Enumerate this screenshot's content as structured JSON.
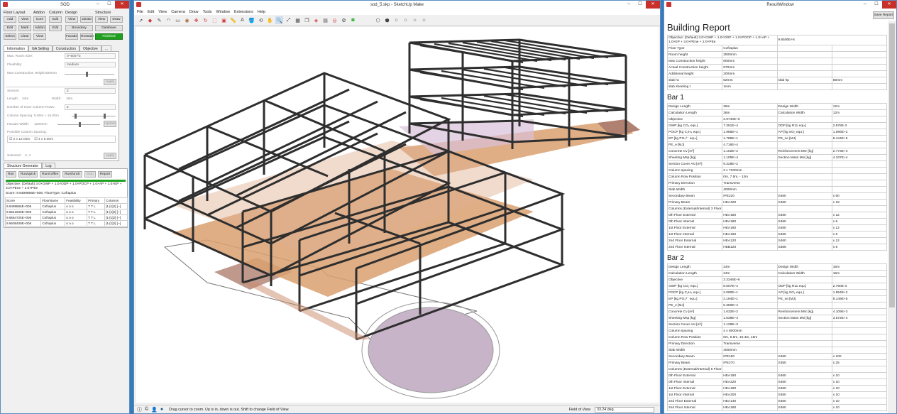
{
  "sod": {
    "title": "SOD",
    "floor_layout": {
      "title": "Floor Layout",
      "buttons": [
        "Add",
        "View",
        "Edit",
        "Mark",
        "Select",
        "Clear"
      ]
    },
    "addon": {
      "title": "Addon",
      "buttons": [
        "Core",
        "Addon",
        "View"
      ]
    },
    "column": {
      "title": "Column",
      "buttons": [
        "Edit",
        "Edit"
      ]
    },
    "design": {
      "title": "Design",
      "buttons": [
        "View",
        "2D/3D",
        "Boundary",
        "Facade",
        "Restrain"
      ]
    },
    "structure": {
      "title": "Structure",
      "buttons": [
        "View",
        "Draw",
        "Database",
        "Finished"
      ]
    },
    "tabs": [
      "Information",
      "GA Setting",
      "Construction",
      "Objective",
      "..."
    ],
    "info": {
      "max_room_size_lbl": "Max. Room Size:",
      "max_room_size": "0~50m^2",
      "flexibility_lbl": "Flexibility:",
      "flexibility": "medium",
      "max_ch_lbl": "Max Construction Height:",
      "max_ch": "600mm",
      "apply": "Apply",
      "storeys_lbl": "Storeys:",
      "storeys": "2",
      "length_lbl": "Length:",
      "length": "24m",
      "width_lbl": "Width:",
      "width": "16m",
      "inner_rows_lbl": "Number of Inner Column Rows:",
      "inner_rows": "2",
      "col_spacing_lbl": "Column Spacing:",
      "col_spacing": "5.00m ~ 15.00m",
      "facade_lbl": "Facade Width:",
      "facade": "1200mm",
      "update": "Update",
      "possible_lbl": "Possible Column Spacing:",
      "opt1": "2 x 12.00m",
      "opt2": "4 x 6.00m",
      "selected_lbl": "Selected:",
      "selected": "2, 4",
      "apply2": "Apply"
    },
    "tabs2": [
      "Structure Generator",
      "Log"
    ],
    "run_buttons": [
      "Run",
      "Run/quick",
      "Run/coffee",
      "Run/lunch",
      "Stop",
      "Report"
    ],
    "objective": "Objective: (Default) 3.0×GWP + 1.0×ODP + 1.0×POCP + 1.0×AP + 1.0×EP + 3.0×PEne + 2.0×PEe",
    "score": "Score: 9.6499866E+006; FloorType: Cofraplus",
    "table": {
      "headers": [
        "Score",
        "FloorName",
        "Feasibility",
        "Primary",
        "Columns"
      ],
      "rows": [
        [
          "9.6499866E+006",
          "Cofraplus",
          "o o o",
          "T T L",
          "[1-[1]2] [--]"
        ],
        [
          "9.6541828E+006",
          "Cofraplus",
          "o o o",
          "T T L",
          "[1-[1]2] [--]"
        ],
        [
          "9.6564725E+006",
          "Cofraplus",
          "o o o",
          "T T L",
          "[1-[1]2] [--]"
        ],
        [
          "9.6605409E+006",
          "Cofraplus",
          "o o o",
          "T T L",
          "[1-[1]2] [--]"
        ]
      ]
    }
  },
  "sketchup": {
    "title": "sod_5.skp - SketchUp Make",
    "menu": [
      "File",
      "Edit",
      "View",
      "Camera",
      "Draw",
      "Tools",
      "Window",
      "Extensions",
      "Help"
    ],
    "status_text": "Drag cursor to zoom.  Up is in, down is out.  Shift to change Field of View.",
    "fov_label": "Field of View",
    "fov_value": "33.24 deg."
  },
  "result": {
    "title": "ResultWindow",
    "save": "Save Report",
    "heading": "Building Report",
    "summary": [
      [
        "Objective: (Default) 3.0×GWP + 1.0×ODP + 1.0×POCP + 1.0×AP + 1.0×EP + 3.0×PEne + 2.0×PEe",
        "9.6500E+6",
        "",
        ""
      ],
      [
        "Floor Type",
        "Cofraplus",
        "",
        ""
      ],
      [
        "Room height",
        "2500mm",
        "",
        ""
      ],
      [
        "Max Construction height",
        "600mm",
        "",
        ""
      ],
      [
        "Actual Construction height",
        "570mm",
        "",
        ""
      ],
      [
        "Additional height",
        "200mm",
        "",
        ""
      ],
      [
        "slab hc",
        "62mm",
        "slab hp",
        "58mm"
      ],
      [
        "slab sheeting t",
        "1mm",
        "",
        ""
      ]
    ],
    "bar1_title": "Bar 1",
    "bar1": [
      [
        "Design Length",
        "36m",
        "Design Width",
        "12m"
      ],
      [
        "Calculation Length",
        "36m",
        "Calculation Width",
        "12m"
      ],
      [
        "Objective",
        "2.9740E+6",
        "",
        ""
      ],
      [
        "GWP [kg CO₂ equ.]",
        "7.351E+4",
        "ODP [kg R11 equ.]",
        "2.878E-3"
      ],
      [
        "POCP [kg C₂H₄ equ.]",
        "1.985E+1",
        "AP [kg SO₂ equ.]",
        "1.596E+2"
      ],
      [
        "EP [kg PO₄³⁻ equ.]",
        "1.785E+1",
        "PE_ne [MJ]",
        "8.444E+5"
      ],
      [
        "PE_e [MJ]",
        "4.716E+4",
        "",
        ""
      ],
      [
        "Concrete Cv [m³]",
        "1.102E+2",
        "Reinforcement Msr [kg]",
        "2.773E+3"
      ],
      [
        "Sheeting Msp [kg]",
        "1.105E+4",
        "Section Mass Msi [kg]",
        "4.337E+4"
      ],
      [
        "Section Cover Asi [m²]",
        "9.328E+2",
        "",
        ""
      ],
      [
        "Column spacing",
        "3  x  7200mm",
        "",
        ""
      ],
      [
        "Column Row Position",
        "0m,       7.5m,      -        12m",
        "",
        ""
      ],
      [
        "Primary Direction",
        "Transverse",
        "",
        ""
      ],
      [
        "Slab Width",
        "4000mm",
        "",
        ""
      ],
      [
        "Secondary Beam",
        "IPE220",
        "S460",
        "x 60"
      ],
      [
        "Primary Beam",
        "HEA400",
        "S460",
        "x 18"
      ],
      [
        "Columns (External/Internal)  3  Floors",
        "",
        "",
        ""
      ],
      [
        "0th  Floor External",
        "HEA180",
        "S460",
        "x 12"
      ],
      [
        "0th  Floor Internal",
        "HEA180",
        "S460",
        "x 6"
      ],
      [
        "1st  Floor External",
        "HEA160",
        "S460",
        "x 12"
      ],
      [
        "1st  Floor Internal",
        "HEA160",
        "S460",
        "x 6"
      ],
      [
        "2nd  Floor External",
        "HEA120",
        "S460",
        "x 12"
      ],
      [
        "2nd  Floor Internal",
        "HEB120",
        "S355",
        "x 6"
      ]
    ],
    "bar2_title": "Bar 2",
    "bar2": [
      [
        "Design Length",
        "24m",
        "Design Width",
        "16m"
      ],
      [
        "Calculation Length",
        "24m",
        "Calculation Width",
        "16m"
      ],
      [
        "Objective",
        "3.3346E+6",
        "",
        ""
      ],
      [
        "GWP [kg CO₂ equ.]",
        "8.607E+4",
        "ODP [kg R11 equ.]",
        "2.760E-3"
      ],
      [
        "POCP [kg C₂H₄ equ.]",
        "2.090E+1",
        "AP [kg SO₂ equ.]",
        "1.854E+2"
      ],
      [
        "EP [kg PO₄³⁻ equ.]",
        "2.194E+1",
        "PE_ne [MJ]",
        "9.149E+5"
      ],
      [
        "PE_e [MJ]",
        "5.350E+4",
        "",
        ""
      ],
      [
        "Concrete Cv [m³]",
        "1.632E+2",
        "Reinforcement Msr [kg]",
        "4.109E+3"
      ],
      [
        "Sheeting Msp [kg]",
        "1.638E+4",
        "Section Mass Msi [kg]",
        "3.572E+4"
      ],
      [
        "Section Cover Asi [m²]",
        "1.129E+3",
        "",
        ""
      ],
      [
        "Column spacing",
        "4  x  6000mm",
        "",
        ""
      ],
      [
        "Column Row Position",
        "0m,       5.6m,      10.4m,      16m",
        "",
        ""
      ],
      [
        "Primary Direction",
        "Transverse",
        "",
        ""
      ],
      [
        "Slab Width",
        "4000mm",
        "",
        ""
      ],
      [
        "Secondary Beam",
        "IPE180",
        "S460",
        "x 100"
      ],
      [
        "Primary Beam",
        "IPE270",
        "S355",
        "x 25"
      ],
      [
        "Columns (External/Internal)  5  Floors",
        "",
        "",
        ""
      ],
      [
        "0th  Floor External",
        "HEA180",
        "S460",
        "x 10"
      ],
      [
        "0th  Floor Internal",
        "HEA220",
        "S460",
        "x 10"
      ],
      [
        "1st  Floor External",
        "HEA180",
        "S460",
        "x 10"
      ],
      [
        "1st  Floor Internal",
        "HEA200",
        "S460",
        "x 10"
      ],
      [
        "2nd  Floor External",
        "HEA140",
        "S460",
        "x 10"
      ],
      [
        "2nd  Floor Internal",
        "HEA180",
        "S460",
        "x 10"
      ]
    ]
  }
}
